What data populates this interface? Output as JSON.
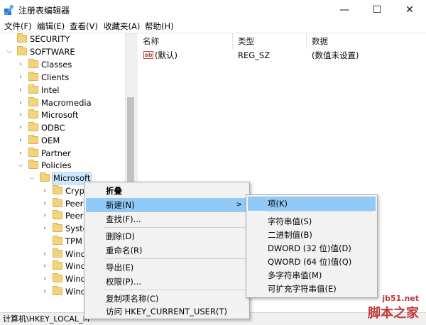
{
  "window": {
    "title": "注册表编辑器",
    "minimize_glyph": "—",
    "maximize_glyph": "☐",
    "close_glyph": "✕"
  },
  "menubar": [
    {
      "label": "文件(F)"
    },
    {
      "label": "编辑(E)"
    },
    {
      "label": "查看(V)"
    },
    {
      "label": "收藏夹(A)"
    },
    {
      "label": "帮助(H)"
    }
  ],
  "tree": {
    "nodes": [
      {
        "label": "SECURITY",
        "arrow": ">"
      },
      {
        "label": "SOFTWARE",
        "arrow": "v"
      },
      {
        "label": "Classes",
        "arrow": ">"
      },
      {
        "label": "Clients",
        "arrow": ">"
      },
      {
        "label": "Intel",
        "arrow": ">"
      },
      {
        "label": "Macromedia",
        "arrow": ">"
      },
      {
        "label": "Microsoft",
        "arrow": ">"
      },
      {
        "label": "ODBC",
        "arrow": ">"
      },
      {
        "label": "OEM",
        "arrow": ">"
      },
      {
        "label": "Partner",
        "arrow": ">"
      },
      {
        "label": "Policies",
        "arrow": "v"
      },
      {
        "label": "Microsoft",
        "arrow": "v"
      },
      {
        "label": "Crypt",
        "arrow": ">"
      },
      {
        "label": "PeerD",
        "arrow": ">"
      },
      {
        "label": "Peern",
        "arrow": ">"
      },
      {
        "label": "Syste",
        "arrow": ">"
      },
      {
        "label": "TPM",
        "arrow": ""
      },
      {
        "label": "Wind",
        "arrow": ">"
      },
      {
        "label": "Wind",
        "arrow": ">"
      },
      {
        "label": "Wind",
        "arrow": ">"
      },
      {
        "label": "Wind",
        "arrow": ">"
      }
    ]
  },
  "list": {
    "columns": [
      "名称",
      "类型",
      "数据"
    ],
    "rows": [
      {
        "icon": "ab",
        "name": "(默认)",
        "type": "REG_SZ",
        "data": "(数值未设置)"
      }
    ]
  },
  "context_menu": {
    "items": [
      "折叠",
      "新建(N)",
      "查找(F)...",
      "删除(D)",
      "重命名(R)",
      "导出(E)",
      "权限(P)...",
      "复制项名称(C)",
      "访问 HKEY_CURRENT_USER(T)"
    ],
    "arrow": ">"
  },
  "submenu": {
    "items": [
      "项(K)",
      "字符串值(S)",
      "二进制值(B)",
      "DWORD (32 位)值(D)",
      "QWORD (64 位)值(Q)",
      "多字符串值(M)",
      "可扩充字符串值(E)"
    ]
  },
  "statusbar": {
    "path": "计算机\\HKEY_LOCAL_M"
  },
  "watermark": {
    "line1": "jb51.net",
    "line2": "脚本之家"
  },
  "colors": {
    "highlight": "#91c9f7",
    "selection": "#cce8ff",
    "folder": "#f3d37d"
  }
}
